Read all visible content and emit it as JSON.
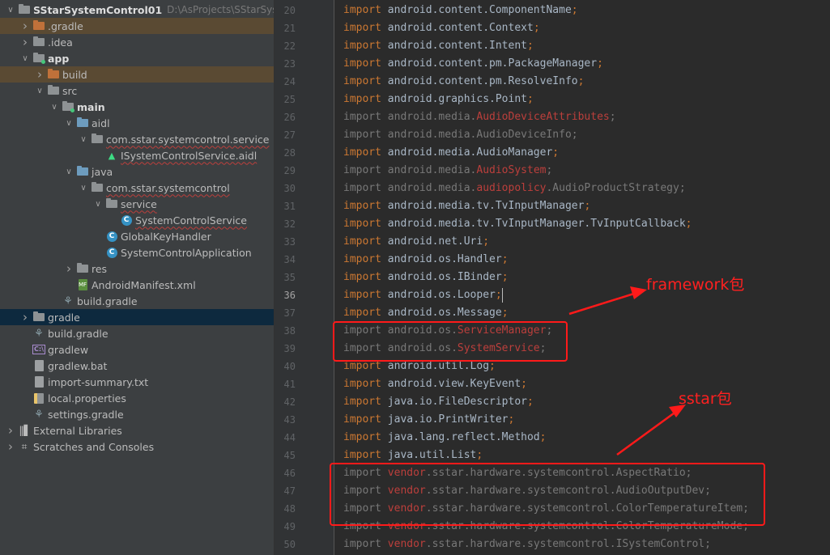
{
  "project_tree": {
    "rows": [
      {
        "depth": 0,
        "arrow": "down",
        "icon": "folder-gray",
        "label": "SStarSystemControl01",
        "path": "D:\\AsProjects\\SStarSystem",
        "style": "proj"
      },
      {
        "depth": 1,
        "arrow": "right",
        "icon": "folder-orange",
        "label": ".gradle",
        "style": "hl-build"
      },
      {
        "depth": 1,
        "arrow": "right",
        "icon": "folder-gray",
        "label": ".idea"
      },
      {
        "depth": 1,
        "arrow": "down",
        "icon": "folder-gray-dot",
        "label": "app",
        "style": "bold"
      },
      {
        "depth": 2,
        "arrow": "right",
        "icon": "folder-orange",
        "label": "build",
        "style": "hl-build"
      },
      {
        "depth": 2,
        "arrow": "down",
        "icon": "folder-gray",
        "label": "src"
      },
      {
        "depth": 3,
        "arrow": "down",
        "icon": "folder-gray-dot",
        "label": "main",
        "style": "bold"
      },
      {
        "depth": 4,
        "arrow": "down",
        "icon": "folder-blue",
        "label": "aidl"
      },
      {
        "depth": 5,
        "arrow": "down",
        "icon": "folder-gray",
        "label": "com.sstar.systemcontrol.service",
        "style": "squig"
      },
      {
        "depth": 6,
        "arrow": "none",
        "icon": "aidl",
        "label": "ISystemControlService.aidl",
        "style": "squig"
      },
      {
        "depth": 4,
        "arrow": "down",
        "icon": "folder-blue",
        "label": "java"
      },
      {
        "depth": 5,
        "arrow": "down",
        "icon": "folder-gray",
        "label": "com.sstar.systemcontrol",
        "style": "squig"
      },
      {
        "depth": 6,
        "arrow": "down",
        "icon": "folder-gray",
        "label": "service",
        "style": "squig"
      },
      {
        "depth": 7,
        "arrow": "none",
        "icon": "class",
        "label": "SystemControlService",
        "style": "squig"
      },
      {
        "depth": 6,
        "arrow": "none",
        "icon": "class",
        "label": "GlobalKeyHandler"
      },
      {
        "depth": 6,
        "arrow": "none",
        "icon": "class",
        "label": "SystemControlApplication"
      },
      {
        "depth": 4,
        "arrow": "right",
        "icon": "folder-gray",
        "label": "res"
      },
      {
        "depth": 4,
        "arrow": "none",
        "icon": "manifest",
        "label": "AndroidManifest.xml"
      },
      {
        "depth": 3,
        "arrow": "none",
        "icon": "gradle",
        "label": "build.gradle"
      },
      {
        "depth": 1,
        "arrow": "right",
        "icon": "folder-gray",
        "label": "gradle",
        "style": "hl-gradle"
      },
      {
        "depth": 1,
        "arrow": "none",
        "icon": "gradle",
        "label": "build.gradle"
      },
      {
        "depth": 1,
        "arrow": "none",
        "icon": "script",
        "label": "gradlew"
      },
      {
        "depth": 1,
        "arrow": "none",
        "icon": "file",
        "label": "gradlew.bat"
      },
      {
        "depth": 1,
        "arrow": "none",
        "icon": "file",
        "label": "import-summary.txt"
      },
      {
        "depth": 1,
        "arrow": "none",
        "icon": "properties",
        "label": "local.properties"
      },
      {
        "depth": 1,
        "arrow": "none",
        "icon": "gradle",
        "label": "settings.gradle"
      },
      {
        "depth": 0,
        "arrow": "right",
        "icon": "libraries",
        "label": "External Libraries"
      },
      {
        "depth": 0,
        "arrow": "right",
        "icon": "scratches",
        "label": "Scratches and Consoles"
      }
    ]
  },
  "editor": {
    "current_line": 36,
    "lines": [
      {
        "n": 20,
        "tokens": [
          [
            "kw",
            "import "
          ],
          [
            "",
            "android.content.ComponentName"
          ],
          [
            "semi",
            ";"
          ]
        ]
      },
      {
        "n": 21,
        "tokens": [
          [
            "kw",
            "import "
          ],
          [
            "",
            "android.content.Context"
          ],
          [
            "semi",
            ";"
          ]
        ]
      },
      {
        "n": 22,
        "tokens": [
          [
            "kw",
            "import "
          ],
          [
            "",
            "android.content.Intent"
          ],
          [
            "semi",
            ";"
          ]
        ]
      },
      {
        "n": 23,
        "tokens": [
          [
            "kw",
            "import "
          ],
          [
            "",
            "android.content.pm.PackageManager"
          ],
          [
            "semi",
            ";"
          ]
        ]
      },
      {
        "n": 24,
        "tokens": [
          [
            "kw",
            "import "
          ],
          [
            "",
            "android.content.pm.ResolveInfo"
          ],
          [
            "semi",
            ";"
          ]
        ]
      },
      {
        "n": 25,
        "tokens": [
          [
            "kw",
            "import "
          ],
          [
            "",
            "android.graphics.Point"
          ],
          [
            "semi",
            ";"
          ]
        ]
      },
      {
        "n": 26,
        "unused": true,
        "tokens": [
          [
            "kw",
            "import "
          ],
          [
            "",
            "android.media."
          ],
          [
            "err",
            "AudioDeviceAttributes"
          ],
          [
            "semi",
            ";"
          ]
        ]
      },
      {
        "n": 27,
        "unused": true,
        "tokens": [
          [
            "kw",
            "import "
          ],
          [
            "",
            "android.media.AudioDeviceInfo"
          ],
          [
            "semi",
            ";"
          ]
        ]
      },
      {
        "n": 28,
        "tokens": [
          [
            "kw",
            "import "
          ],
          [
            "",
            "android.media.AudioManager"
          ],
          [
            "semi",
            ";"
          ]
        ]
      },
      {
        "n": 29,
        "unused": true,
        "tokens": [
          [
            "kw",
            "import "
          ],
          [
            "",
            "android.media."
          ],
          [
            "err",
            "AudioSystem"
          ],
          [
            "semi",
            ";"
          ]
        ]
      },
      {
        "n": 30,
        "unused": true,
        "tokens": [
          [
            "kw",
            "import "
          ],
          [
            "",
            "android.media."
          ],
          [
            "err",
            "audiopolicy"
          ],
          [
            "",
            ".AudioProductStrategy"
          ],
          [
            "semi",
            ";"
          ]
        ]
      },
      {
        "n": 31,
        "tokens": [
          [
            "kw",
            "import "
          ],
          [
            "",
            "android.media.tv.TvInputManager"
          ],
          [
            "semi",
            ";"
          ]
        ]
      },
      {
        "n": 32,
        "tokens": [
          [
            "kw",
            "import "
          ],
          [
            "",
            "android.media.tv.TvInputManager.TvInputCallback"
          ],
          [
            "semi",
            ";"
          ]
        ]
      },
      {
        "n": 33,
        "tokens": [
          [
            "kw",
            "import "
          ],
          [
            "",
            "android.net.Uri"
          ],
          [
            "semi",
            ";"
          ]
        ]
      },
      {
        "n": 34,
        "tokens": [
          [
            "kw",
            "import "
          ],
          [
            "",
            "android.os.Handler"
          ],
          [
            "semi",
            ";"
          ]
        ]
      },
      {
        "n": 35,
        "tokens": [
          [
            "kw",
            "import "
          ],
          [
            "",
            "android.os.IBinder"
          ],
          [
            "semi",
            ";"
          ]
        ]
      },
      {
        "n": 36,
        "tokens": [
          [
            "kw",
            "import "
          ],
          [
            "",
            "android.os.Looper"
          ],
          [
            "semi",
            ";"
          ]
        ]
      },
      {
        "n": 37,
        "tokens": [
          [
            "kw",
            "import "
          ],
          [
            "",
            "android.os.Message"
          ],
          [
            "semi",
            ";"
          ]
        ]
      },
      {
        "n": 38,
        "unused": true,
        "tokens": [
          [
            "kw",
            "import "
          ],
          [
            "",
            "android.os."
          ],
          [
            "err",
            "ServiceManager"
          ],
          [
            "semi",
            ";"
          ]
        ]
      },
      {
        "n": 39,
        "unused": true,
        "tokens": [
          [
            "kw",
            "import "
          ],
          [
            "",
            "android.os."
          ],
          [
            "err",
            "SystemService"
          ],
          [
            "semi",
            ";"
          ]
        ]
      },
      {
        "n": 40,
        "tokens": [
          [
            "kw",
            "import "
          ],
          [
            "",
            "android.util.Log"
          ],
          [
            "semi",
            ";"
          ]
        ]
      },
      {
        "n": 41,
        "tokens": [
          [
            "kw",
            "import "
          ],
          [
            "",
            "android.view.KeyEvent"
          ],
          [
            "semi",
            ";"
          ]
        ]
      },
      {
        "n": 42,
        "tokens": [
          [
            "kw",
            "import "
          ],
          [
            "",
            "java.io.FileDescriptor"
          ],
          [
            "semi",
            ";"
          ]
        ]
      },
      {
        "n": 43,
        "tokens": [
          [
            "kw",
            "import "
          ],
          [
            "",
            "java.io.PrintWriter"
          ],
          [
            "semi",
            ";"
          ]
        ]
      },
      {
        "n": 44,
        "tokens": [
          [
            "kw",
            "import "
          ],
          [
            "",
            "java.lang.reflect.Method"
          ],
          [
            "semi",
            ";"
          ]
        ]
      },
      {
        "n": 45,
        "tokens": [
          [
            "kw",
            "import "
          ],
          [
            "",
            "java.util.List"
          ],
          [
            "semi",
            ";"
          ]
        ]
      },
      {
        "n": 46,
        "unused": true,
        "tokens": [
          [
            "kw",
            "import "
          ],
          [
            "err",
            "vendor"
          ],
          [
            "",
            ".sstar.hardware.systemcontrol.AspectRatio"
          ],
          [
            "semi",
            ";"
          ]
        ]
      },
      {
        "n": 47,
        "unused": true,
        "tokens": [
          [
            "kw",
            "import "
          ],
          [
            "err",
            "vendor"
          ],
          [
            "",
            ".sstar.hardware.systemcontrol.AudioOutputDev"
          ],
          [
            "semi",
            ";"
          ]
        ]
      },
      {
        "n": 48,
        "unused": true,
        "tokens": [
          [
            "kw",
            "import "
          ],
          [
            "err",
            "vendor"
          ],
          [
            "",
            ".sstar.hardware.systemcontrol.ColorTemperatureItem"
          ],
          [
            "semi",
            ";"
          ]
        ]
      },
      {
        "n": 49,
        "unused": true,
        "tokens": [
          [
            "kw",
            "import "
          ],
          [
            "err",
            "vendor"
          ],
          [
            "",
            ".sstar.hardware.systemcontrol.ColorTemperatureMode"
          ],
          [
            "semi",
            ";"
          ]
        ]
      },
      {
        "n": 50,
        "unused": true,
        "tokens": [
          [
            "kw",
            "import "
          ],
          [
            "err",
            "vendor"
          ],
          [
            "",
            ".sstar.hardware.systemcontrol.ISystemControl"
          ],
          [
            "semi",
            ";"
          ]
        ]
      }
    ]
  },
  "annotations": {
    "framework_label": "framework包",
    "sstar_label": "sstar包",
    "color": "#ff1a1a"
  }
}
